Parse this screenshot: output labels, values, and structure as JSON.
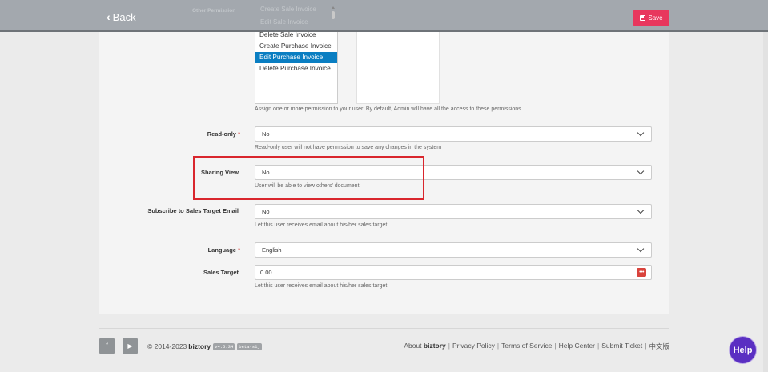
{
  "header": {
    "back_label": "Back",
    "save_label": "Save"
  },
  "permissions": {
    "label": "Other Permission",
    "items_behind_header": [
      "Create Sale Invoice",
      "Edit Sale Invoice"
    ],
    "items": [
      {
        "label": "Delete Sale Invoice",
        "selected": false
      },
      {
        "label": "Create Purchase Invoice",
        "selected": false
      },
      {
        "label": "Edit Purchase Invoice",
        "selected": true
      },
      {
        "label": "Delete Purchase Invoice",
        "selected": false
      }
    ],
    "help": "Assign one or more permission to your user. By default, Admin will have all the access to these permissions."
  },
  "readonly": {
    "label": "Read-only",
    "required_mark": "*",
    "value": "No",
    "help": "Read-only user will not have permission to save any changes in the system"
  },
  "sharing_view": {
    "label": "Sharing View",
    "value": "No",
    "help": "User will be able to view others' document"
  },
  "subscribe": {
    "label": "Subscribe to Sales Target Email",
    "value": "No",
    "help": "Let this user receives email about his/her sales target"
  },
  "language": {
    "label": "Language",
    "required_mark": "*",
    "value": "English"
  },
  "sales_target": {
    "label": "Sales Target",
    "value": "0.00",
    "help": "Let this user receives email about his/her sales target"
  },
  "footer": {
    "facebook_glyph": "f",
    "youtube_glyph": "▶",
    "copyright": "© 2014-2023",
    "brand": "biztory",
    "version": "v4.5.34",
    "beta": "beta-s1j",
    "about_prefix": "About",
    "about_brand": "biztory",
    "links": [
      "Privacy Policy",
      "Terms of Service",
      "Help Center",
      "Submit Ticket",
      "中文版"
    ],
    "separator": "|",
    "help_button": "Help"
  },
  "colors": {
    "save_button": "#e8375d",
    "selected_item": "#0a7ec2",
    "highlight_box": "#d9262d",
    "help_button": "#5a2fc2"
  }
}
